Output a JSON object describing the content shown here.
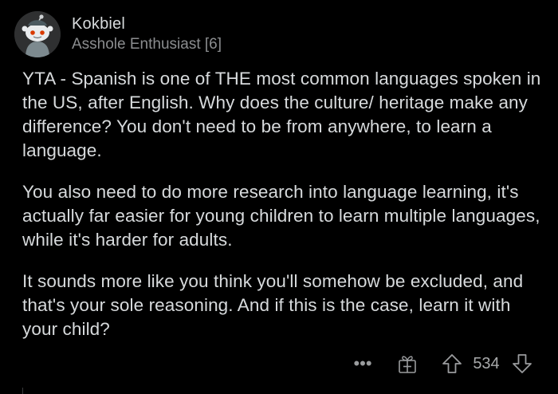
{
  "comment": {
    "author": "Kokbiel",
    "flair": "Asshole Enthusiast [6]",
    "avatar": "snoo-avatar",
    "paragraphs": [
      "YTA - Spanish is one of THE most common languages spoken in the US, after English. Why does the culture/ heritage make any difference? You don't need to be from anywhere, to learn a language.",
      "You also need to do more research into language learning, it's actually far easier for young children to learn multiple languages, while it's harder for adults.",
      "It sounds more like you think you'll somehow be excluded, and that's your sole reasoning. And if this is the case, learn it with your child?"
    ],
    "actions": {
      "more_icon": "more-icon",
      "more_glyph": "•••",
      "award_icon": "award-icon",
      "upvote_icon": "upvote-arrow-icon",
      "score": "534",
      "downvote_icon": "downvote-arrow-icon"
    }
  },
  "colors": {
    "background": "#000000",
    "text": "#d7dadc",
    "muted": "#8b8d8f",
    "icon": "#9a9c9e"
  }
}
